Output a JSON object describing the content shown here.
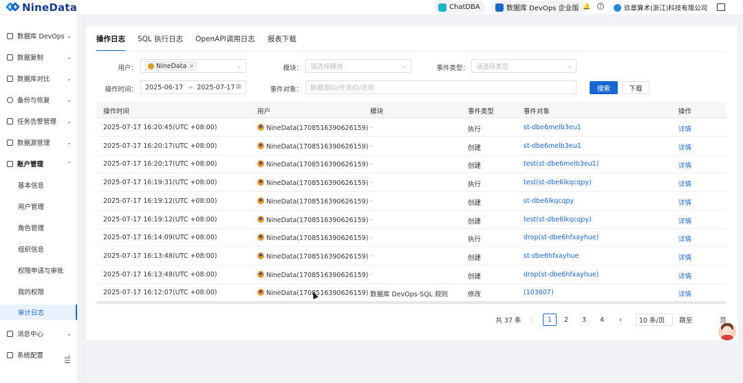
{
  "header": {
    "logo_text": "NineData",
    "chatdba": "ChatDBA",
    "edition": "数据库 DevOps 企业版",
    "org_name": "玖章算术(浙江)科技有限公司"
  },
  "sidebar": {
    "items": [
      {
        "label": "数据库 DevOps"
      },
      {
        "label": "数据复制"
      },
      {
        "label": "数据库对比"
      },
      {
        "label": "备份与恢复"
      },
      {
        "label": "任务告警管理"
      },
      {
        "label": "数据源管理"
      },
      {
        "label": "账户管理"
      }
    ],
    "sub_items": [
      {
        "label": "基本信息"
      },
      {
        "label": "用户管理"
      },
      {
        "label": "角色管理"
      },
      {
        "label": "组织信息"
      },
      {
        "label": "权限申请与审批"
      },
      {
        "label": "我的权限"
      },
      {
        "label": "审计日志"
      }
    ],
    "bottom_items": [
      {
        "label": "消息中心"
      },
      {
        "label": "系统配置"
      }
    ]
  },
  "tabs": [
    {
      "label": "操作日志"
    },
    {
      "label": "SQL 执行日志"
    },
    {
      "label": "OpenAPI调用日志"
    },
    {
      "label": "报表下载"
    }
  ],
  "filters": {
    "user_label": "用户：",
    "user_tag": "NineData",
    "module_label": "模块：",
    "module_placeholder": "请选择模块",
    "event_type_label": "事件类型：",
    "event_type_placeholder": "请选择类型",
    "time_label": "操作时间：",
    "date_start": "2025-06-17",
    "date_sep": "→",
    "date_end": "2025-07-17",
    "event_object_label": "事件对象：",
    "event_object_placeholder": "数据源ID/任务ID/名称",
    "search_button": "搜索",
    "download_button": "下载"
  },
  "table": {
    "columns": [
      "操作时间",
      "用户",
      "模块",
      "事件类型",
      "事件对象",
      "操作"
    ],
    "rows": [
      {
        "time": "2025-07-17 16:20:45(UTC +08:00)",
        "user": "NineData(1708516390626159)",
        "module": "-",
        "event_type": "执行",
        "object": "st-dbe6melb3eu1",
        "action": "详情"
      },
      {
        "time": "2025-07-17 16:20:17(UTC +08:00)",
        "user": "NineData(1708516390626159)",
        "module": "-",
        "event_type": "创建",
        "object": "st-dbe6melb3eu1",
        "action": "详情"
      },
      {
        "time": "2025-07-17 16:20:17(UTC +08:00)",
        "user": "NineData(1708516390626159)",
        "module": "-",
        "event_type": "创建",
        "object": "test(st-dbe6melb3eu1)",
        "action": "详情"
      },
      {
        "time": "2025-07-17 16:19:31(UTC +08:00)",
        "user": "NineData(1708516390626159)",
        "module": "-",
        "event_type": "执行",
        "object": "test(st-dbe6lkqcqpy)",
        "action": "详情"
      },
      {
        "time": "2025-07-17 16:19:12(UTC +08:00)",
        "user": "NineData(1708516390626159)",
        "module": "-",
        "event_type": "创建",
        "object": "st-dbe6lkqcqpy",
        "action": "详情"
      },
      {
        "time": "2025-07-17 16:19:12(UTC +08:00)",
        "user": "NineData(1708516390626159)",
        "module": "-",
        "event_type": "创建",
        "object": "test(st-dbe6lkqcqpy)",
        "action": "详情"
      },
      {
        "time": "2025-07-17 16:14:09(UTC +08:00)",
        "user": "NineData(1708516390626159)",
        "module": "-",
        "event_type": "执行",
        "object": "drop(st-dbe6hfxayhue)",
        "action": "详情"
      },
      {
        "time": "2025-07-17 16:13:48(UTC +08:00)",
        "user": "NineData(1708516390626159)",
        "module": "-",
        "event_type": "创建",
        "object": "st-dbe6hfxayhue",
        "action": "详情"
      },
      {
        "time": "2025-07-17 16:13:48(UTC +08:00)",
        "user": "NineData(1708516390626159)",
        "module": "-",
        "event_type": "创建",
        "object": "drop(st-dbe6hfxayhue)",
        "action": "详情"
      },
      {
        "time": "2025-07-17 16:12:07(UTC +08:00)",
        "user": "NineData(1708516390626159)",
        "module": "数据库 DevOps-SQL 规则",
        "event_type": "修改",
        "object": "(103607)",
        "action": "详情"
      }
    ]
  },
  "pagination": {
    "total": "共 37 条",
    "prev": "‹",
    "pages": [
      "1",
      "2",
      "3",
      "4"
    ],
    "next": "›",
    "page_size": "10 条/页",
    "goto_label": "跳至",
    "page_suffix": "页"
  }
}
